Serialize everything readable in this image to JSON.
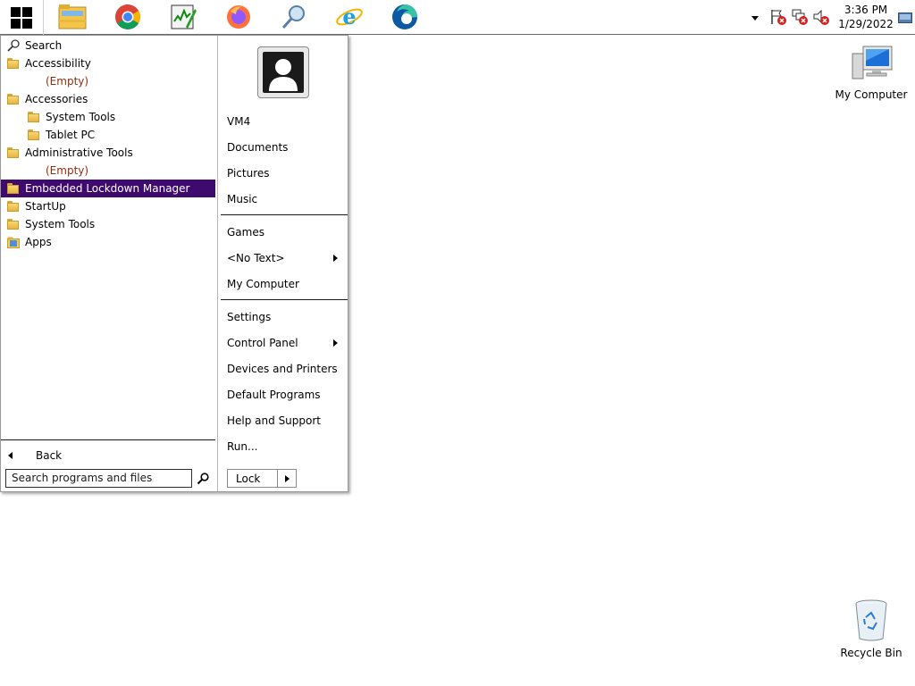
{
  "taskbar": {
    "pinned": [
      "file-explorer-icon",
      "chrome-icon",
      "task-manager-icon",
      "firefox-icon",
      "search-icon",
      "internet-explorer-icon",
      "edge-icon"
    ],
    "clock_time": "3:36 PM",
    "clock_date": "1/29/2022"
  },
  "start_menu": {
    "programs": [
      {
        "label": "Search",
        "icon": "search-icon",
        "indent": 0
      },
      {
        "label": "Accessibility",
        "icon": "folder-icon",
        "indent": 0
      },
      {
        "label": "(Empty)",
        "icon": "none",
        "indent": 2
      },
      {
        "label": "Accessories",
        "icon": "folder-icon",
        "indent": 0
      },
      {
        "label": "System Tools",
        "icon": "folder-icon",
        "indent": 1
      },
      {
        "label": "Tablet PC",
        "icon": "folder-icon",
        "indent": 1
      },
      {
        "label": "Administrative Tools",
        "icon": "folder-icon",
        "indent": 0
      },
      {
        "label": "(Empty)",
        "icon": "none",
        "indent": 2
      },
      {
        "label": "Embedded Lockdown Manager",
        "icon": "folder-icon",
        "indent": 0,
        "selected": true
      },
      {
        "label": "StartUp",
        "icon": "folder-icon",
        "indent": 0
      },
      {
        "label": "System Tools",
        "icon": "folder-icon",
        "indent": 0
      },
      {
        "label": "Apps",
        "icon": "apps-icon",
        "indent": 0
      }
    ],
    "back_label": "Back",
    "search_placeholder": "Search programs and files",
    "right": {
      "user": "VM4",
      "group1": [
        "Documents",
        "Pictures",
        "Music"
      ],
      "group2": [
        "Games",
        "<No Text>",
        "My Computer"
      ],
      "group3": [
        "Settings",
        "Control Panel",
        "Devices and Printers",
        "Default Programs",
        "Help and Support",
        "Run..."
      ],
      "lock_label": "Lock"
    }
  },
  "desktop": {
    "my_computer": "My Computer",
    "recycle_bin": "Recycle Bin"
  },
  "colors": {
    "selection": "#3f0a6e"
  }
}
